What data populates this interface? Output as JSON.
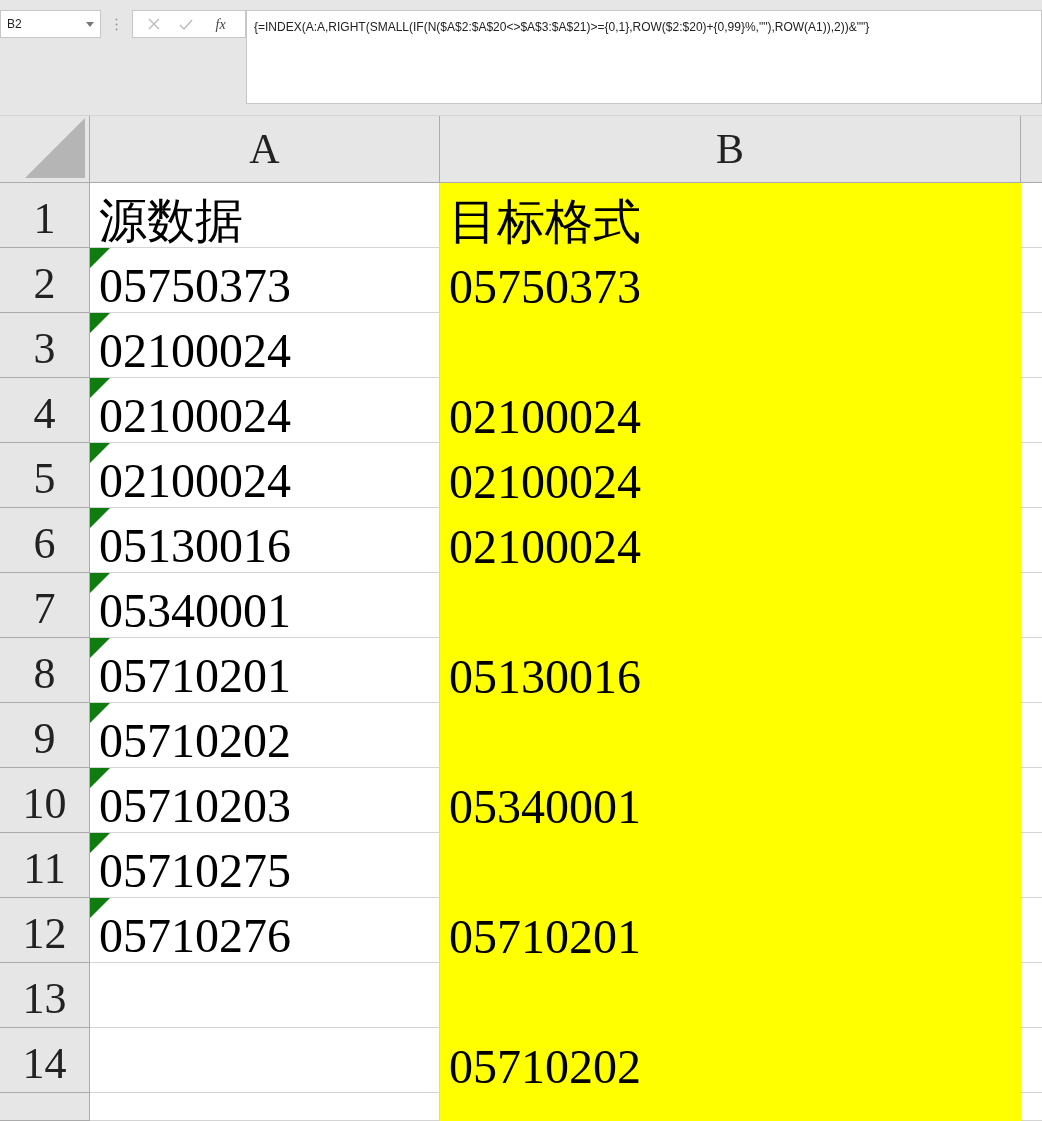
{
  "formula_bar": {
    "name_box": "B2",
    "function_label": "fx",
    "formula": "{=INDEX(A:A,RIGHT(SMALL(IF(N($A$2:$A$20<>$A$3:$A$21)>={0,1},ROW($2:$20)+{0,99}%,\"\"),ROW(A1)),2))&\"\"}"
  },
  "columns": [
    {
      "label": "A"
    },
    {
      "label": "B"
    }
  ],
  "rows": [
    {
      "number": "1",
      "cells": [
        {
          "text": "源数据",
          "flag": false
        },
        {
          "text": "目标格式",
          "flag": false
        }
      ]
    },
    {
      "number": "2",
      "cells": [
        {
          "text": "05750373",
          "flag": true
        },
        {
          "text": "05750373",
          "flag": false
        }
      ]
    },
    {
      "number": "3",
      "cells": [
        {
          "text": "02100024",
          "flag": true
        },
        {
          "flag": false
        }
      ]
    },
    {
      "number": "4",
      "cells": [
        {
          "text": "02100024",
          "flag": true
        },
        {
          "text": "02100024",
          "flag": false
        }
      ]
    },
    {
      "number": "5",
      "cells": [
        {
          "text": "02100024",
          "flag": true
        },
        {
          "text": "02100024",
          "flag": false
        }
      ]
    },
    {
      "number": "6",
      "cells": [
        {
          "text": "05130016",
          "flag": true
        },
        {
          "text": "02100024",
          "flag": false
        }
      ]
    },
    {
      "number": "7",
      "cells": [
        {
          "text": "05340001",
          "flag": true
        },
        {
          "flag": false
        }
      ]
    },
    {
      "number": "8",
      "cells": [
        {
          "text": "05710201",
          "flag": true
        },
        {
          "text": "05130016",
          "flag": false
        }
      ]
    },
    {
      "number": "9",
      "cells": [
        {
          "text": "05710202",
          "flag": true
        },
        {
          "flag": false
        }
      ]
    },
    {
      "number": "10",
      "cells": [
        {
          "text": "05710203",
          "flag": true
        },
        {
          "text": "05340001",
          "flag": false
        }
      ]
    },
    {
      "number": "11",
      "cells": [
        {
          "text": "05710275",
          "flag": true
        },
        {
          "flag": false
        }
      ]
    },
    {
      "number": "12",
      "cells": [
        {
          "text": "05710276",
          "flag": true
        },
        {
          "text": "05710201",
          "flag": false
        }
      ]
    },
    {
      "number": "13",
      "cells": [
        {
          "flag": false
        },
        {
          "flag": false
        }
      ]
    },
    {
      "number": "14",
      "cells": [
        {
          "flag": false
        },
        {
          "text": "05710202",
          "flag": false
        }
      ]
    },
    {
      "cells": [
        {
          "flag": false
        },
        {
          "flag": false
        }
      ]
    }
  ]
}
